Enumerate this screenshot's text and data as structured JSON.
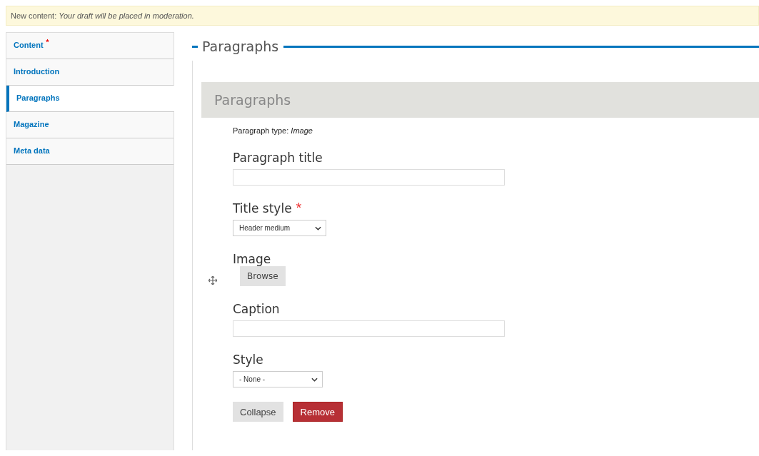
{
  "message": {
    "label": "New content:",
    "text": "Your draft will be placed in moderation."
  },
  "tabs": [
    {
      "label": "Content",
      "mark": "*",
      "selected": false
    },
    {
      "label": "Introduction",
      "selected": false
    },
    {
      "label": "Paragraphs",
      "selected": true
    },
    {
      "label": "Magazine",
      "selected": false
    },
    {
      "label": "Meta data",
      "selected": false
    }
  ],
  "fieldset": {
    "legend": "Paragraphs",
    "section_title": "Paragraphs",
    "paragraph_type": "Paragraph type: *Image*",
    "fields": [
      {
        "kind": "text",
        "label": "Paragraph title"
      },
      {
        "kind": "select",
        "label": "Title style",
        "mark": "*",
        "value": "Header medium"
      },
      {
        "kind": "file",
        "label": "Image",
        "button": "Browse"
      },
      {
        "kind": "text",
        "label": "Caption"
      },
      {
        "kind": "select",
        "label": "Style",
        "value": "- None -"
      }
    ],
    "buttons": [
      {
        "kind": "default",
        "label": "Collapse"
      },
      {
        "kind": "danger",
        "label": "Remove"
      }
    ]
  }
}
